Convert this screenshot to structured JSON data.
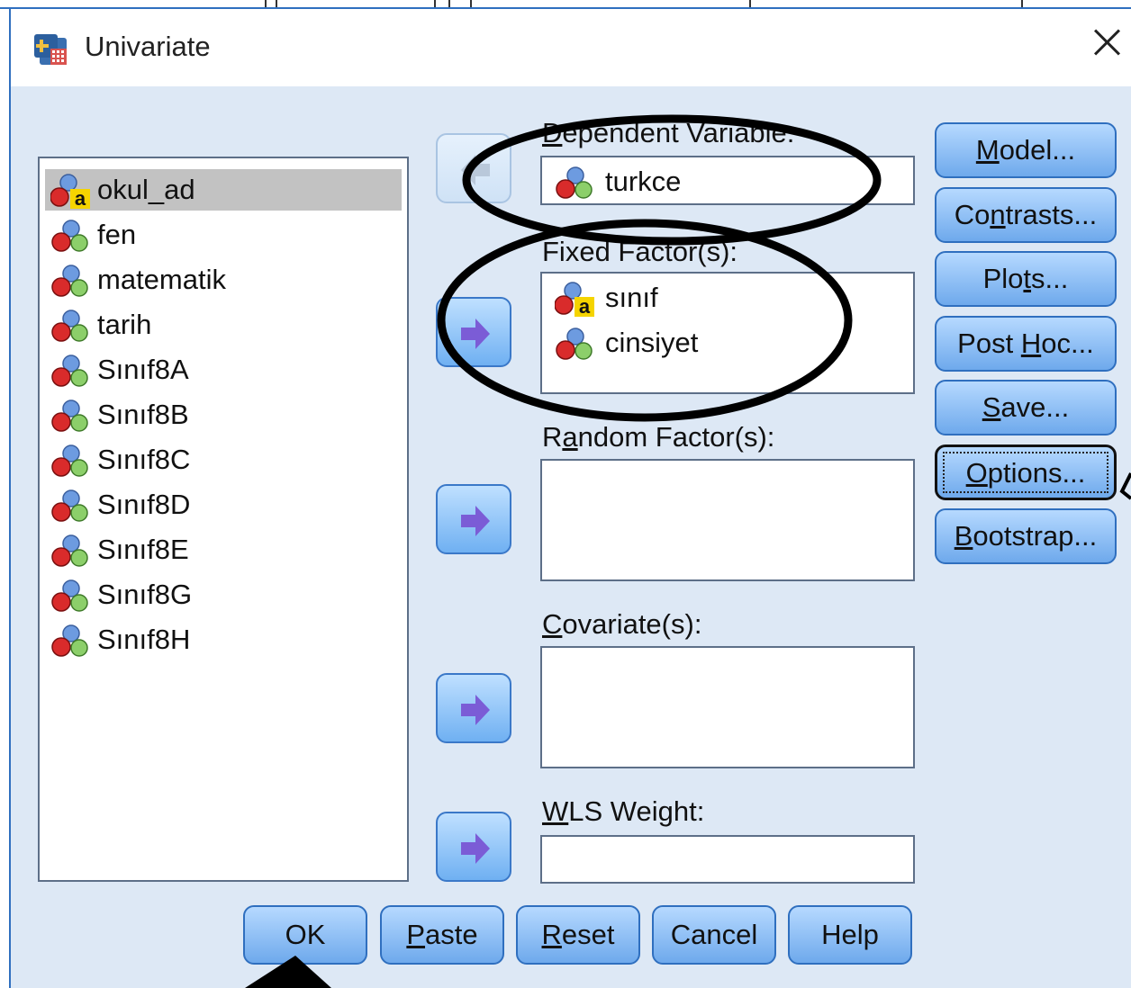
{
  "window": {
    "title": "Univariate"
  },
  "variables": [
    {
      "name": "okul_ad",
      "type": "string-nominal",
      "selected": true
    },
    {
      "name": "fen",
      "type": "scale"
    },
    {
      "name": "matematik",
      "type": "scale"
    },
    {
      "name": "tarih",
      "type": "scale"
    },
    {
      "name": "Sınıf8A",
      "type": "scale"
    },
    {
      "name": "Sınıf8B",
      "type": "scale"
    },
    {
      "name": "Sınıf8C",
      "type": "scale"
    },
    {
      "name": "Sınıf8D",
      "type": "scale"
    },
    {
      "name": "Sınıf8E",
      "type": "scale"
    },
    {
      "name": "Sınıf8G",
      "type": "scale"
    },
    {
      "name": "Sınıf8H",
      "type": "scale"
    }
  ],
  "fields": {
    "dependent": {
      "label_u": "D",
      "label_rest": "ependent Variable:",
      "items": [
        "turkce"
      ]
    },
    "fixed": {
      "label": "Fixed Factor(s):",
      "items": [
        "sınıf",
        "cinsiyet"
      ]
    },
    "random": {
      "label_a": "R",
      "label_u": "a",
      "label_rest": "ndom Factor(s):"
    },
    "covariates": {
      "label_u": "C",
      "label_rest": "ovariate(s):"
    },
    "wls": {
      "label_u": "W",
      "label_rest": "LS Weight:"
    }
  },
  "side_buttons": [
    {
      "pre": "",
      "u": "M",
      "post": "odel..."
    },
    {
      "pre": "Co",
      "u": "n",
      "post": "trasts..."
    },
    {
      "pre": "Plo",
      "u": "t",
      "post": "s..."
    },
    {
      "pre": "Post ",
      "u": "H",
      "post": "oc..."
    },
    {
      "pre": "",
      "u": "S",
      "post": "ave..."
    },
    {
      "pre": "",
      "u": "O",
      "post": "ptions..."
    },
    {
      "pre": "",
      "u": "B",
      "post": "ootstrap..."
    }
  ],
  "bottom_buttons": [
    {
      "pre": "",
      "u": "",
      "post": "OK"
    },
    {
      "pre": "",
      "u": "P",
      "post": "aste"
    },
    {
      "pre": "",
      "u": "R",
      "post": "eset"
    },
    {
      "pre": "",
      "u": "",
      "post": "Cancel"
    },
    {
      "pre": "",
      "u": "",
      "post": "Help"
    }
  ],
  "colors": {
    "accent": "#2f6fbf",
    "dialog_bg": "#dde8f5",
    "annotation": "#000000"
  },
  "icons": {
    "title": "spss-dialog-icon",
    "scale_var": "scale-variable-icon",
    "nominal_var": "nominal-string-variable-icon",
    "move": "move-arrow-icon",
    "close": "close-icon"
  }
}
